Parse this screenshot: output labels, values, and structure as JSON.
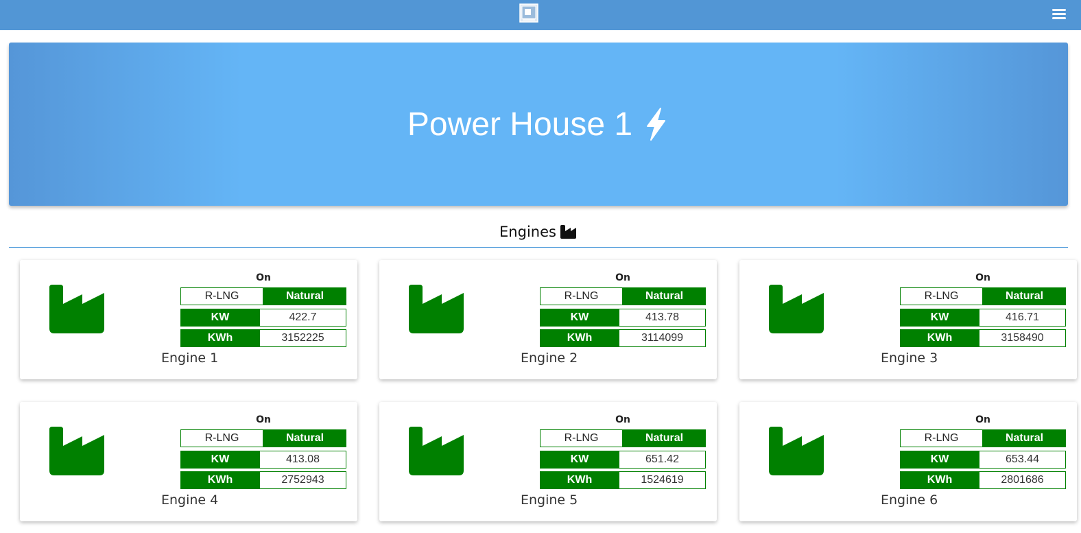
{
  "header": {
    "logo_icon": "app-logo-icon",
    "menu_icon": "hamburger-menu-icon",
    "bar_color": "#5296d5"
  },
  "hero": {
    "title": "Power House 1",
    "icon": "lightning-bolt-icon"
  },
  "section": {
    "title": "Engines",
    "icon": "factory-icon"
  },
  "colors": {
    "accent_green": "#008000",
    "hero_blue": "#64b5f6"
  },
  "engines": [
    {
      "name": "Engine 1",
      "status": "On",
      "fuel_options": [
        "R-LNG",
        "Natural"
      ],
      "selected_fuel": "Natural",
      "kw_label": "KW",
      "kw": "422.7",
      "kwh_label": "KWh",
      "kwh": "3152225"
    },
    {
      "name": "Engine 2",
      "status": "On",
      "fuel_options": [
        "R-LNG",
        "Natural"
      ],
      "selected_fuel": "Natural",
      "kw_label": "KW",
      "kw": "413.78",
      "kwh_label": "KWh",
      "kwh": "3114099"
    },
    {
      "name": "Engine 3",
      "status": "On",
      "fuel_options": [
        "R-LNG",
        "Natural"
      ],
      "selected_fuel": "Natural",
      "kw_label": "KW",
      "kw": "416.71",
      "kwh_label": "KWh",
      "kwh": "3158490"
    },
    {
      "name": "Engine 4",
      "status": "On",
      "fuel_options": [
        "R-LNG",
        "Natural"
      ],
      "selected_fuel": "Natural",
      "kw_label": "KW",
      "kw": "413.08",
      "kwh_label": "KWh",
      "kwh": "2752943"
    },
    {
      "name": "Engine 5",
      "status": "On",
      "fuel_options": [
        "R-LNG",
        "Natural"
      ],
      "selected_fuel": "Natural",
      "kw_label": "KW",
      "kw": "651.42",
      "kwh_label": "KWh",
      "kwh": "1524619"
    },
    {
      "name": "Engine 6",
      "status": "On",
      "fuel_options": [
        "R-LNG",
        "Natural"
      ],
      "selected_fuel": "Natural",
      "kw_label": "KW",
      "kw": "653.44",
      "kwh_label": "KWh",
      "kwh": "2801686"
    }
  ]
}
